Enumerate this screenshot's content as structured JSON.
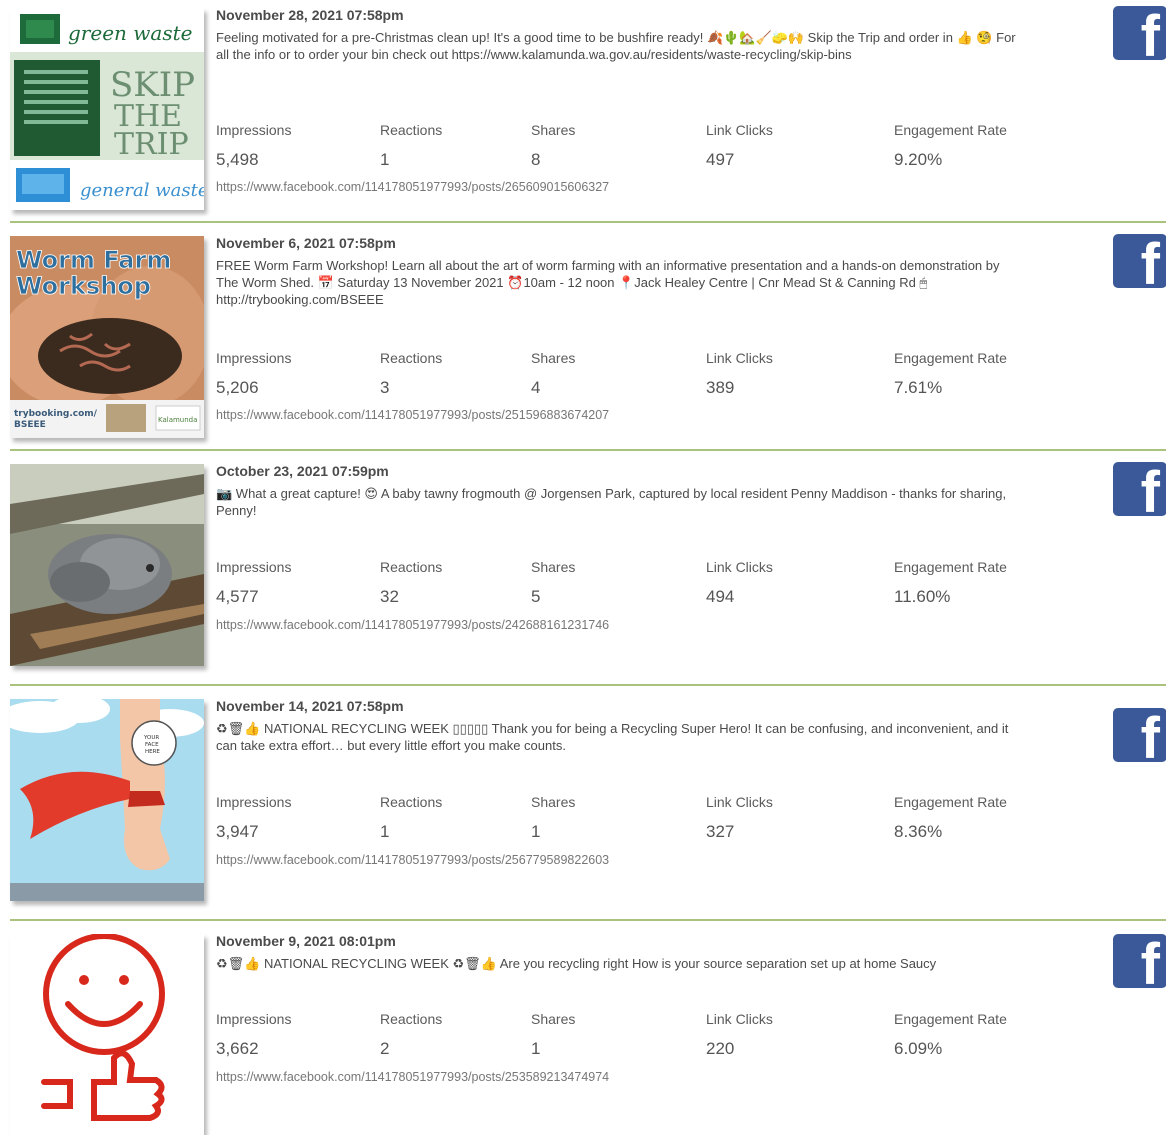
{
  "metric_labels": {
    "impressions": "Impressions",
    "reactions": "Reactions",
    "shares": "Shares",
    "link_clicks": "Link Clicks",
    "engagement_rate": "Engagement Rate"
  },
  "facebook_glyph": "f",
  "thumb_text": {
    "green_waste": "green waste",
    "skip": "SKIP",
    "the": "THE",
    "trip": "TRIP",
    "general_waste": "general waste",
    "worm_line1": "Worm Farm",
    "worm_line2": "Workshop",
    "trybooking": "trybooking.com/",
    "bseee": "BSEEE",
    "kalamunda": "Kalamunda",
    "your": "YOUR",
    "face": "FACE",
    "here": "HERE"
  },
  "colors": {
    "divider": "#a9c27e",
    "facebook": "#3b5998"
  },
  "posts": [
    {
      "date": "November 28, 2021 07:58pm",
      "message": "Feeling motivated for a pre-Christmas clean up! It's a good time to be bushfire ready! 🍂🌵🏡🧹🧽🙌      Skip the Trip and order in 👍     🧐     For all the info or to order your bin check out https://www.kalamunda.wa.gov.au/residents/waste-recycling/skip-bins",
      "impressions": "5,498",
      "reactions": "1",
      "shares": "8",
      "link_clicks": "497",
      "engagement_rate": "9.20%",
      "url": "https://www.facebook.com/114178051977993/posts/265609015606327"
    },
    {
      "date": "November 6, 2021 07:58pm",
      "message": "FREE Worm Farm Workshop! Learn all about the art of worm farming with an informative presentation and a hands-on demonstration by The Worm Shed. 📅 Saturday 13 November 2021 ⏰10am - 12 noon 📍Jack Healey Centre | Cnr Mead St & Canning Rd 🖱http://trybooking.com/BSEEE",
      "impressions": "5,206",
      "reactions": "3",
      "shares": "4",
      "link_clicks": "389",
      "engagement_rate": "7.61%",
      "url": "https://www.facebook.com/114178051977993/posts/251596883674207"
    },
    {
      "date": "October 23, 2021 07:59pm",
      "message": "📷 What a great capture! 😍 A baby tawny frogmouth @ Jorgensen Park, captured by local resident Penny Maddison - thanks for sharing, Penny!",
      "impressions": "4,577",
      "reactions": "32",
      "shares": "5",
      "link_clicks": "494",
      "engagement_rate": "11.60%",
      "url": "https://www.facebook.com/114178051977993/posts/242688161231746"
    },
    {
      "date": "November 14, 2021 07:58pm",
      "message": "♻🗑👍 NATIONAL RECYCLING WEEK ▯▯▯▯▯ Thank you for being a Recycling Super Hero! It can be confusing, and inconvenient, and it can take extra effort… but every little effort you make counts.",
      "impressions": "3,947",
      "reactions": "1",
      "shares": "1",
      "link_clicks": "327",
      "engagement_rate": "8.36%",
      "url": "https://www.facebook.com/114178051977993/posts/256779589822603"
    },
    {
      "date": "November 9, 2021 08:01pm",
      "message": "♻🗑👍     NATIONAL RECYCLING WEEK ♻🗑👍 Are you recycling right How is your source separation set up at home Saucy",
      "impressions": "3,662",
      "reactions": "2",
      "shares": "1",
      "link_clicks": "220",
      "engagement_rate": "6.09%",
      "url": "https://www.facebook.com/114178051977993/posts/253589213474974"
    }
  ]
}
